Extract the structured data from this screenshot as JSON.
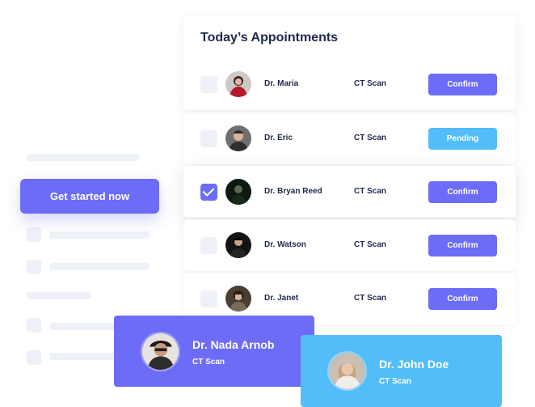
{
  "cta": {
    "label": "Get started now"
  },
  "appointments": {
    "title": "Today’s Appointments",
    "rows": [
      {
        "doctor": "Dr. Maria",
        "service": "CT Scan",
        "status": "Confirm",
        "checked": false,
        "avatar_icon": "doctor-avatar"
      },
      {
        "doctor": "Dr. Eric",
        "service": "CT Scan",
        "status": "Pending",
        "checked": false,
        "avatar_icon": "doctor-avatar"
      },
      {
        "doctor": "Dr. Bryan Reed",
        "service": "CT Scan",
        "status": "Confirm",
        "checked": true,
        "avatar_icon": "doctor-avatar"
      },
      {
        "doctor": "Dr. Watson",
        "service": "CT Scan",
        "status": "Confirm",
        "checked": false,
        "avatar_icon": "doctor-avatar"
      },
      {
        "doctor": "Dr. Janet",
        "service": "CT Scan",
        "status": "Confirm",
        "checked": false,
        "avatar_icon": "doctor-avatar"
      }
    ]
  },
  "cards": [
    {
      "name": "Dr. Nada Arnob",
      "service": "CT Scan"
    },
    {
      "name": "Dr. John Doe",
      "service": "CT Scan"
    }
  ],
  "colors": {
    "primary": "#6c6cf6",
    "pending": "#53bdf9",
    "text_dark": "#1f2a4a",
    "skeleton": "#eef1f8"
  }
}
